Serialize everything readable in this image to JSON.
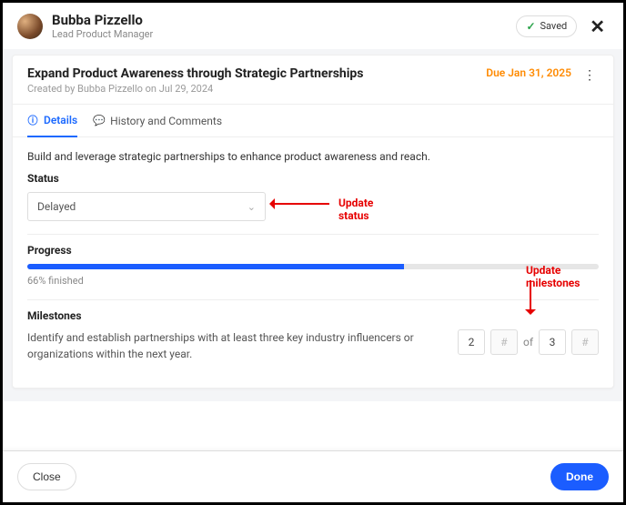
{
  "header": {
    "name": "Bubba Pizzello",
    "role": "Lead Product Manager",
    "saved_label": "Saved"
  },
  "goal": {
    "title": "Expand Product Awareness through Strategic Partnerships",
    "created": "Created by Bubba Pizzello on Jul 29, 2024",
    "due": "Due Jan 31, 2025"
  },
  "tabs": {
    "details": "Details",
    "history": "History and Comments"
  },
  "details": {
    "description": "Build and leverage strategic partnerships to enhance product awareness and reach.",
    "status_label": "Status",
    "status_value": "Delayed",
    "progress_label": "Progress",
    "progress_text": "66% finished",
    "milestones_label": "Milestones",
    "milestones_desc": "Identify and establish partnerships with at least three key industry influencers or organizations within the next year.",
    "milestone_done": "2",
    "milestone_total": "3",
    "hash": "#",
    "of": "of"
  },
  "footer": {
    "close": "Close",
    "done": "Done"
  },
  "annot": {
    "status": "Update status",
    "milestones": "Update milestones"
  }
}
